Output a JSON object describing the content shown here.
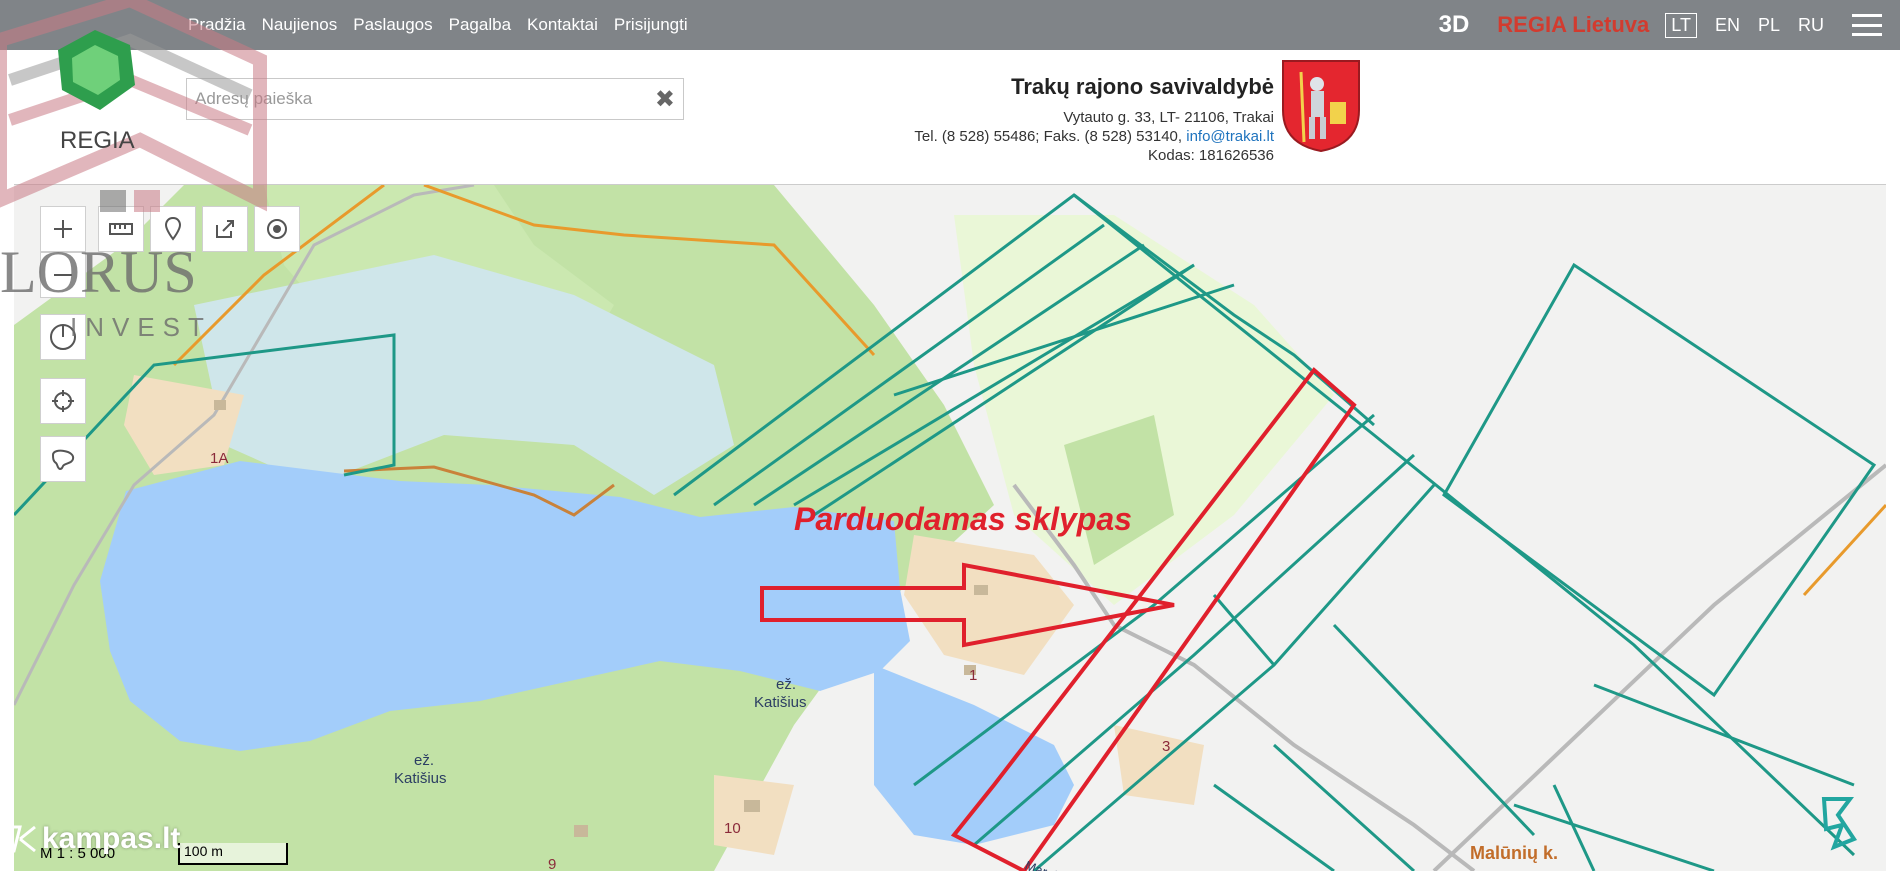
{
  "nav": {
    "items": [
      "Pradžia",
      "Naujienos",
      "Paslaugos",
      "Pagalba",
      "Kontaktai",
      "Prisijungti"
    ]
  },
  "topbar_right": {
    "btn_3d": "3D",
    "regia": "REGIA Lietuva",
    "langs": [
      "LT",
      "EN",
      "PL",
      "RU"
    ],
    "active_lang": "LT"
  },
  "search": {
    "placeholder": "Adresų paieška",
    "clear": "✖"
  },
  "municipality": {
    "name": "Trakų rajono savivaldybė",
    "address": "Vytauto g. 33, LT- 21106, Trakai",
    "phone": "Tel. (8 528) 55486; Faks. (8 528) 53140, ",
    "email": "info@trakai.lt",
    "code": "Kodas: 181626536"
  },
  "logo": {
    "regia": "REGIA",
    "company": "LORUS",
    "company_sub": "INVEST"
  },
  "map": {
    "annotation": "Parduodamas sklypas",
    "lake_label_1": "ež.",
    "lake_name_1": "Katišius",
    "lake_label_2": "ež.",
    "lake_name_2": "Katišius",
    "plot_1a": "1A",
    "plot_1": "1",
    "plot_3": "3",
    "plot_10": "10",
    "plot_9": "9",
    "village": "Malūnių k.",
    "road": "Margio"
  },
  "scale": {
    "ratio": "M 1 : 5 000",
    "bar": "100 m"
  },
  "watermark": "kampas.lt",
  "colors": {
    "topbar": "#808488",
    "lake": "#a3cdfa",
    "forest": "#c2e2a6",
    "parcel_line": "#1e9887",
    "highlight": "#e0202c",
    "boundary": "#e89a2c"
  }
}
